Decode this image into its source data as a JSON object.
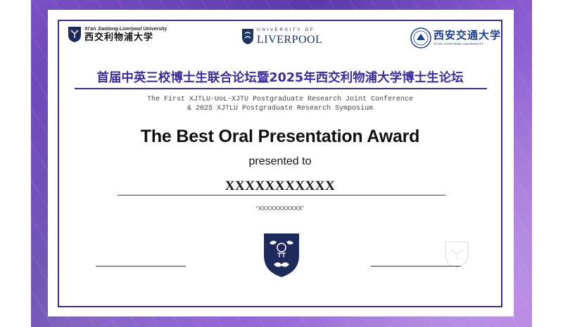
{
  "logos": {
    "xjtlu": {
      "english": "Xi'an Jiaotong-Liverpool University",
      "chinese": "西交利物浦大学"
    },
    "uol": {
      "top": "UNIVERSITY OF",
      "bottom": "LIVERPOOL"
    },
    "xjtu": {
      "chinese": "西安交通大学",
      "english": "XI'AN JIAOTONG UNIVERSITY"
    }
  },
  "certificate": {
    "title_cn": "首届中英三校博士生联合论坛暨2025年西交利物浦大学博士生论坛",
    "subtitle_line1": "The First XJTLU-UoL-XJTU Postgraduate Research Joint Conference",
    "subtitle_line2": "& 2025 XJTLU Postgraduate Research Symposium",
    "award_title": "The Best Oral Presentation Award",
    "presented_to": "presented to",
    "recipient": "XXXXXXXXXXX",
    "quote": "“XXXXXXXXXXX”"
  },
  "colors": {
    "accent": "#3e2c8a",
    "background": "#6a45b8",
    "shield": "#1e2a5a"
  }
}
